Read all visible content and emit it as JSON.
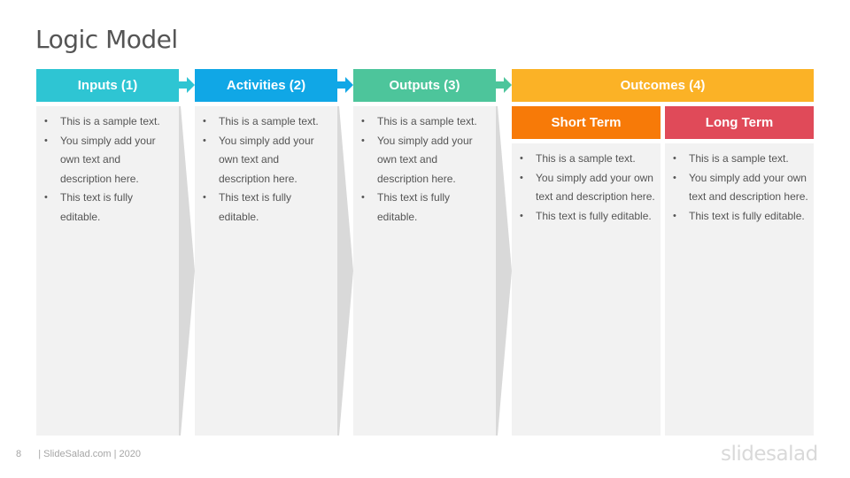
{
  "title": "Logic Model",
  "colors": {
    "inputs": "#2ec5d3",
    "activities": "#10a7e6",
    "outputs": "#4dc59b",
    "outcomes": "#fbb226",
    "short_term": "#f77a08",
    "long_term": "#e04a59",
    "panel": "#f2f2f2",
    "chevron": "#d9d9d9"
  },
  "columns": [
    {
      "key": "inputs",
      "label": "Inputs (1)",
      "bullets": [
        "This is a sample text.",
        "You simply add your own text and description here.",
        "This text is fully editable."
      ]
    },
    {
      "key": "activities",
      "label": "Activities (2)",
      "bullets": [
        "This is a sample text.",
        "You simply add your own text and description here.",
        "This text is fully editable."
      ]
    },
    {
      "key": "outputs",
      "label": "Outputs (3)",
      "bullets": [
        "This is a sample text.",
        "You simply add your own text and description here.",
        "This text is fully editable."
      ]
    }
  ],
  "outcomes": {
    "label": "Outcomes (4)",
    "short_term": {
      "label": "Short Term",
      "bullets": [
        "This is a sample text.",
        "You simply add your own text and description here.",
        "This text is fully editable."
      ]
    },
    "long_term": {
      "label": "Long Term",
      "bullets": [
        "This is a sample text.",
        "You simply add your own text and description here.",
        "This text is fully editable."
      ]
    }
  },
  "footer": {
    "page_number": "8",
    "credit": "| SlideSalad.com | 2020"
  },
  "brand": {
    "logo_text": "slidesalad"
  }
}
